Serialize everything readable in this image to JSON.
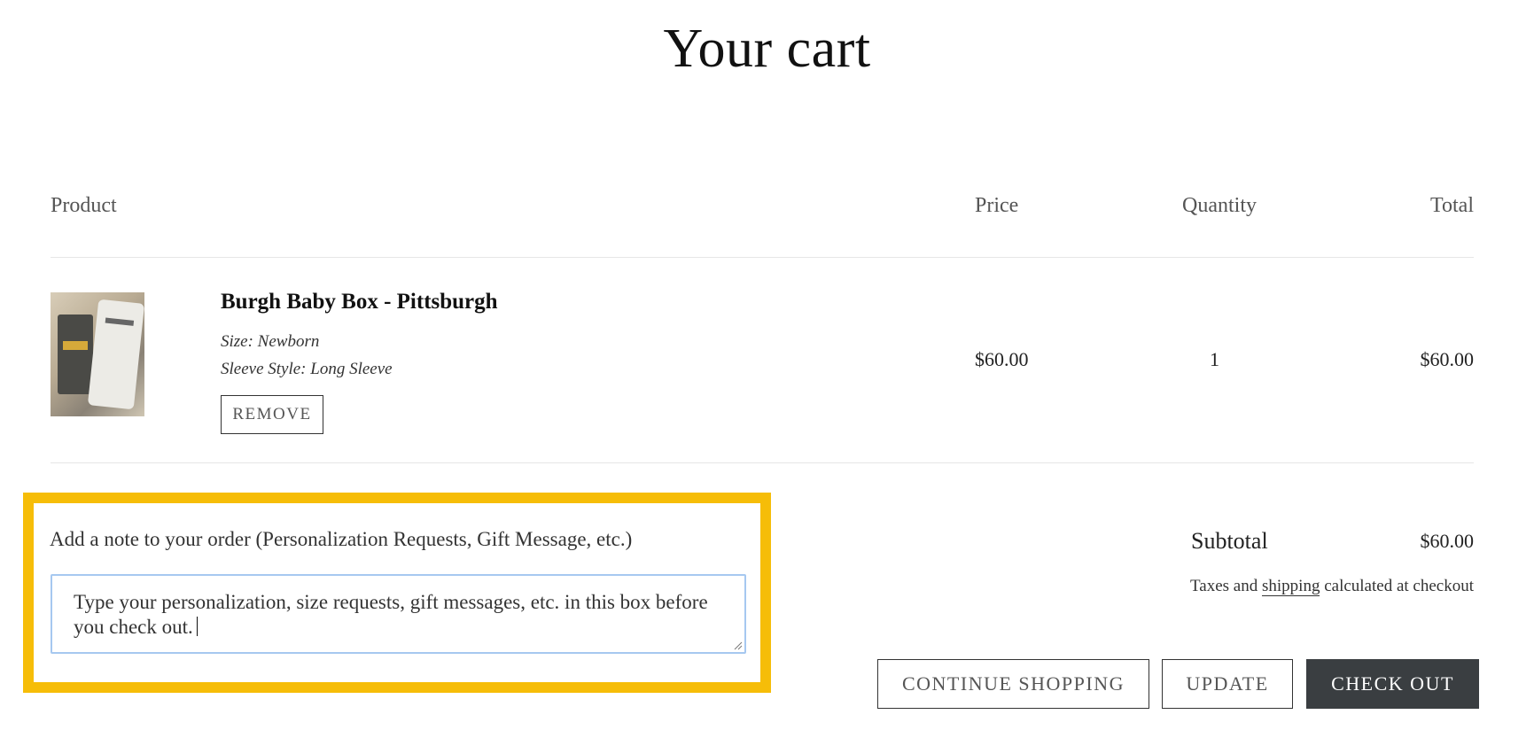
{
  "page": {
    "title": "Your cart"
  },
  "table": {
    "headers": {
      "product": "Product",
      "price": "Price",
      "quantity": "Quantity",
      "total": "Total"
    }
  },
  "items": [
    {
      "name": "Burgh Baby Box - Pittsburgh",
      "size": "Size: Newborn",
      "sleeve": "Sleeve Style: Long Sleeve",
      "remove_label": "REMOVE",
      "price": "$60.00",
      "quantity": "1",
      "total": "$60.00",
      "thumbnail_icon": "product-image"
    }
  ],
  "note": {
    "label": "Add a note to your order (Personalization Requests, Gift Message, etc.)",
    "value": "Type your personalization, size requests, gift messages, etc. in this box before you check out.",
    "highlight_color": "#f6bd08",
    "focus_border_color": "#a6c8f0"
  },
  "summary": {
    "subtotal_label": "Subtotal",
    "subtotal_value": "$60.00",
    "tax_prefix": "Taxes and",
    "shipping_link": "shipping",
    "tax_suffix": "calculated at checkout"
  },
  "actions": {
    "continue_label": "CONTINUE SHOPPING",
    "update_label": "UPDATE",
    "checkout_label": "CHECK OUT",
    "checkout_bg": "#3a3e41"
  }
}
